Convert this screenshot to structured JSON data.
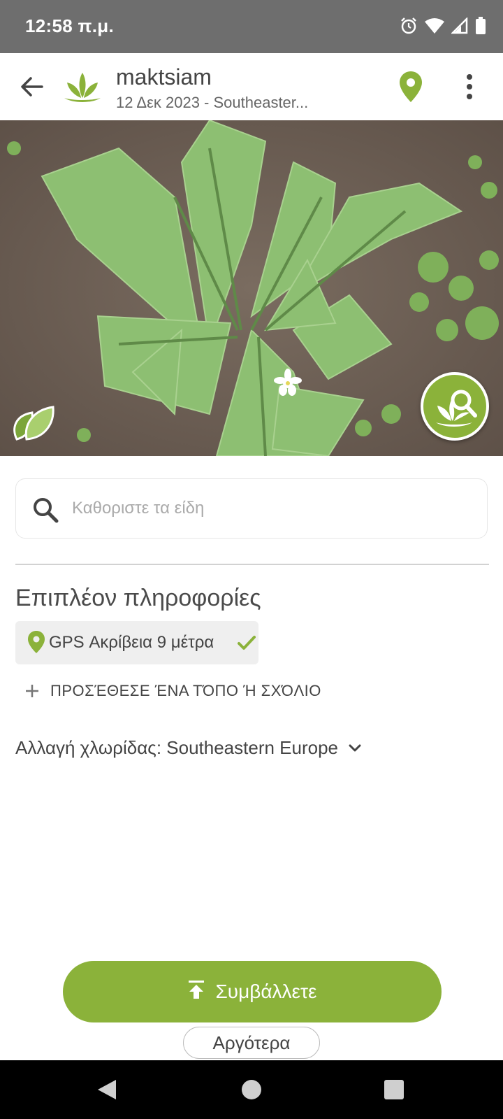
{
  "status_bar": {
    "time": "12:58 π.μ.",
    "icons": [
      "alarm-icon",
      "wifi-icon",
      "cell-signal-icon",
      "battery-icon"
    ]
  },
  "app_bar": {
    "title": "maktsiam",
    "subtitle": "12 Δεκ 2023 - Southeaster...",
    "icons": [
      "back-arrow-icon",
      "plantnet-logo",
      "location-pin-icon",
      "more-vert-icon"
    ]
  },
  "photo": {
    "badge_icon": "leaf-badge-icon",
    "identify_button_icon": "plant-search-icon"
  },
  "search": {
    "placeholder": "Καθοριστε τα είδη"
  },
  "more_info": {
    "title": "Επιπλέον πληροφορίες",
    "gps_label": "GPS Ακρίβεια 9 μέτρα",
    "add_note_label": "ΠΡΟΣΈΘΕΣΕ ΈΝΑ ΤΌΠΟ Ή ΣΧΌΛΙΟ",
    "flora_label": "Αλλαγή χλωρίδας: Southeastern Europe"
  },
  "actions": {
    "contribute_label": "Συμβάλλετε",
    "later_label": "Αργότερα"
  },
  "colors": {
    "accent": "#8bb23a",
    "status_bar": "#6e6e6e",
    "nav_bar": "#000000"
  }
}
